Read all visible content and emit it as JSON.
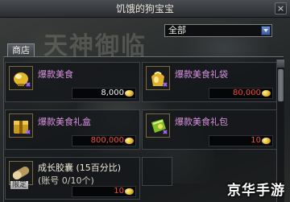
{
  "window": {
    "title": "饥饿的狗宝宝",
    "close_label": "×"
  },
  "banner": {
    "text": "天神御临"
  },
  "category_select": {
    "selected": "全部"
  },
  "tabs": [
    {
      "label": "商店"
    }
  ],
  "items": [
    {
      "name": "爆款美食",
      "sub": "",
      "price": "8,000",
      "price_color": "#f2f2f2",
      "icon": "golden-trophy-icon"
    },
    {
      "name": "爆款美食礼袋",
      "sub": "",
      "price": "80,000",
      "price_color": "#f04a3a",
      "icon": "golden-gift-bag-icon"
    },
    {
      "name": "爆款美食礼盒",
      "sub": "",
      "price": "800,000",
      "price_color": "#f04a3a",
      "icon": "golden-gift-box-icon"
    },
    {
      "name": "爆款美食礼包",
      "sub": "",
      "price": "10",
      "price_color": "#f04a3a",
      "icon": "green-gift-pack-icon"
    },
    {
      "name": "成长胶囊 (15百分比)",
      "sub": "(账号 0/10个)",
      "price": "10",
      "price_color": "#f04a3a",
      "icon": "capsule-icon",
      "tag": "限定"
    }
  ],
  "watermark": {
    "text": "京华手游"
  }
}
